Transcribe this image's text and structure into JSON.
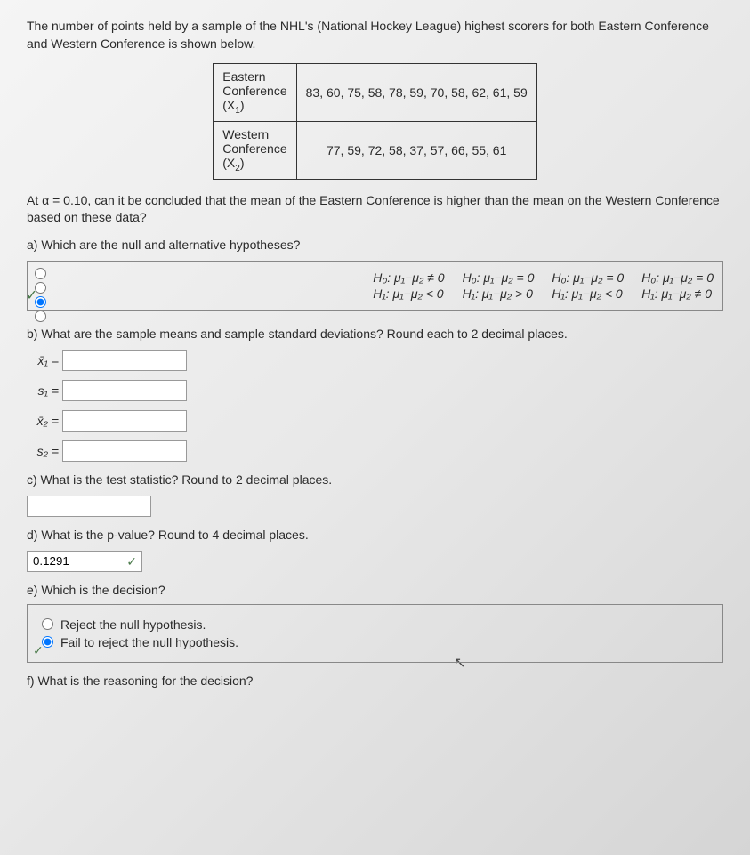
{
  "intro": "The number of points held by a sample of the NHL's (National Hockey League) highest scorers for both Eastern Conference and Western Conference is shown below.",
  "table": {
    "row1_label": "Eastern Conference (X₁)",
    "row1_data": "83, 60, 75, 58, 78, 59, 70, 58, 62, 61, 59",
    "row2_label": "Western Conference (X₂)",
    "row2_data": "77, 59, 72, 58, 37, 57, 66, 55, 61"
  },
  "alpha_text": "At α = 0.10, can it be concluded that the mean of the Eastern Conference is higher than the mean on the Western Conference based on these data?",
  "part_a": "a) Which are the null and alternative hypotheses?",
  "hypotheses": {
    "opt1_h0": "H₀: μ₁−μ₂ = 0",
    "opt1_h1": "H₁: μ₁−μ₂ ≠ 0",
    "opt2_h0": "H₀: μ₁−μ₂ = 0",
    "opt2_h1": "H₁: μ₁−μ₂ < 0",
    "opt3_h0": "H₀: μ₁−μ₂ = 0",
    "opt3_h1": "H₁: μ₁−μ₂ > 0",
    "opt4_h0": "H₀: μ₁−μ₂ ≠ 0",
    "opt4_h1": "H₁: μ₁−μ₂ < 0"
  },
  "part_b": "b) What are the sample means and sample standard deviations?  Round each to 2 decimal places.",
  "labels": {
    "x1bar": "x̄₁ =",
    "s1": "s₁ =",
    "x2bar": "x̄₂ =",
    "s2": "s₂ ="
  },
  "part_c": "c) What is the test statistic?  Round to 2 decimal places.",
  "part_d": "d) What is the p-value?  Round to 4 decimal places.",
  "pvalue": "0.1291",
  "part_e": "e) Which is the decision?",
  "decisions": {
    "reject": "Reject the null hypothesis.",
    "fail": "Fail to reject the null hypothesis."
  },
  "part_f": "f) What is the reasoning for the decision?"
}
